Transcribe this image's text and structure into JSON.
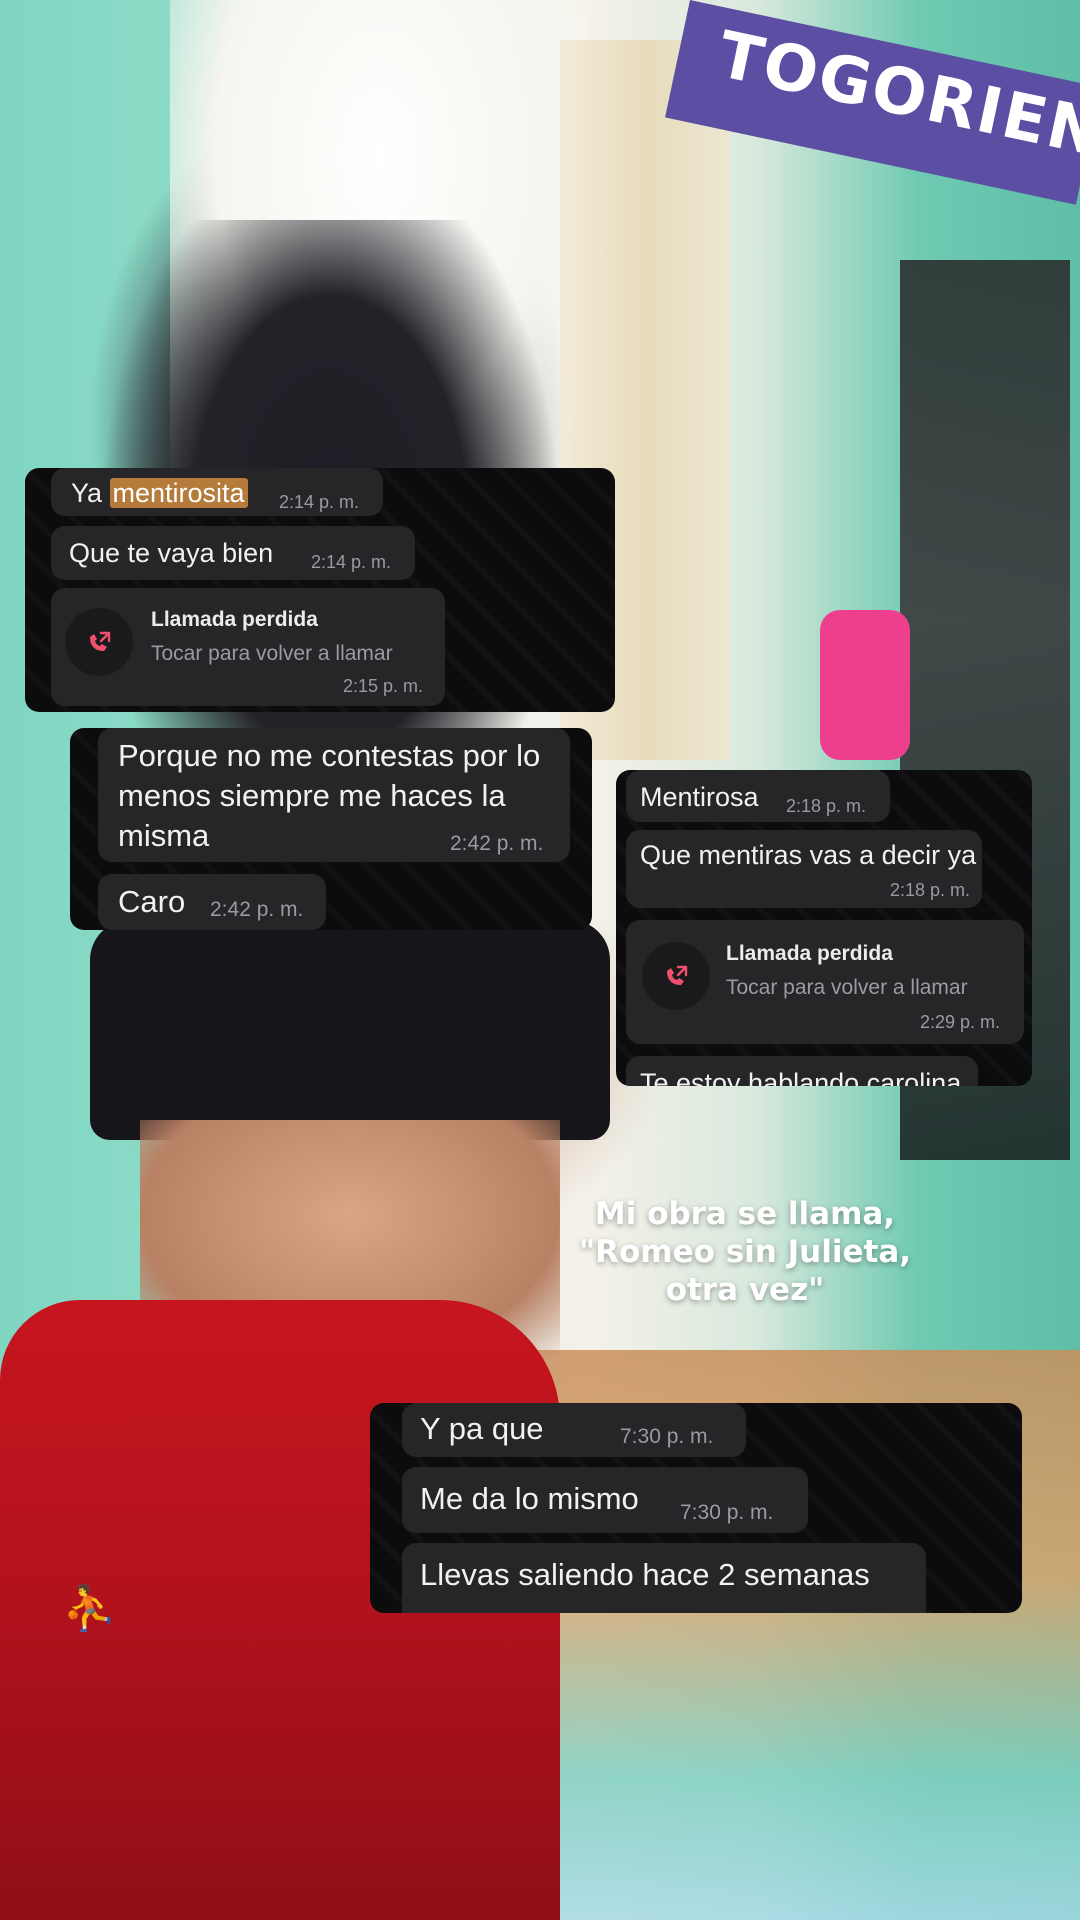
{
  "background": {
    "banner_text": "TOGORIEN"
  },
  "card1": {
    "messages": [
      {
        "prefix": "Ya ",
        "highlight": "mentirosita",
        "time": "2:14 p. m."
      },
      {
        "text": "Que te vaya bien",
        "time": "2:14 p. m."
      }
    ],
    "call": {
      "title": "Llamada perdida",
      "subtitle": "Tocar para volver a llamar",
      "time": "2:15 p. m."
    }
  },
  "card2": {
    "messages": [
      {
        "lines": [
          "Porque no me contestas por lo",
          "menos siempre me haces la",
          "misma"
        ],
        "time": "2:42 p. m."
      },
      {
        "text": "Caro",
        "time": "2:42 p. m."
      }
    ]
  },
  "card3": {
    "messages": [
      {
        "text": "Mentirosa",
        "time": "2:18 p. m."
      },
      {
        "text": "Que mentiras vas a decir ya",
        "time": "2:18 p. m."
      }
    ],
    "call": {
      "title": "Llamada perdida",
      "subtitle": "Tocar para volver a llamar",
      "time": "2:29 p. m."
    },
    "partial": {
      "text": "Te estoy hablando carolina"
    }
  },
  "caption": {
    "lines": [
      "Mi obra se llama,",
      "\"Romeo sin Julieta,",
      "otra vez\""
    ]
  },
  "card4": {
    "messages": [
      {
        "text": "Y pa que",
        "time": "7:30 p. m."
      },
      {
        "text": "Me da lo mismo",
        "time": "7:30 p. m."
      },
      {
        "text": "Llevas saliendo hace 2 semanas"
      }
    ]
  },
  "colors": {
    "card_bg": "#0c0c0e",
    "bubble_bg": "#262629",
    "highlight": "#b57b3b",
    "missed_call_red": "#f0506e"
  },
  "icons": {
    "missed_call": "missed-call-icon"
  }
}
